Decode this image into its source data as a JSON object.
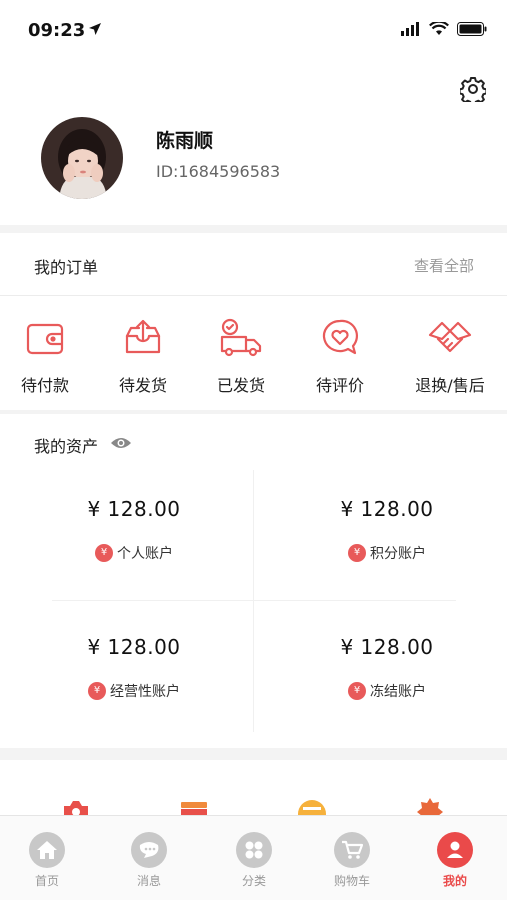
{
  "status_bar": {
    "time": "09:23"
  },
  "profile": {
    "name": "陈雨顺",
    "id_text": "ID:1684596583"
  },
  "orders": {
    "title": "我的订单",
    "view_all": "查看全部",
    "items": [
      {
        "label": "待付款",
        "icon": "wallet-icon"
      },
      {
        "label": "待发货",
        "icon": "box-upload-icon"
      },
      {
        "label": "已发货",
        "icon": "truck-icon"
      },
      {
        "label": "待评价",
        "icon": "comment-heart-icon"
      },
      {
        "label": "退换/售后",
        "icon": "handshake-icon"
      }
    ]
  },
  "assets": {
    "title": "我的资产",
    "accounts": [
      {
        "amount": "¥ 128.00",
        "label": "个人账户"
      },
      {
        "amount": "¥ 128.00",
        "label": "积分账户"
      },
      {
        "amount": "¥ 128.00",
        "label": "经营性账户"
      },
      {
        "amount": "¥ 128.00",
        "label": "冻结账户"
      }
    ]
  },
  "tabbar": {
    "items": [
      {
        "label": "首页",
        "icon": "home-icon"
      },
      {
        "label": "消息",
        "icon": "message-icon"
      },
      {
        "label": "分类",
        "icon": "category-icon"
      },
      {
        "label": "购物车",
        "icon": "cart-icon"
      },
      {
        "label": "我的",
        "icon": "user-icon",
        "active": true
      }
    ]
  },
  "colors": {
    "accent": "#ea4a4a",
    "icon_stroke": "#e85a5a"
  }
}
